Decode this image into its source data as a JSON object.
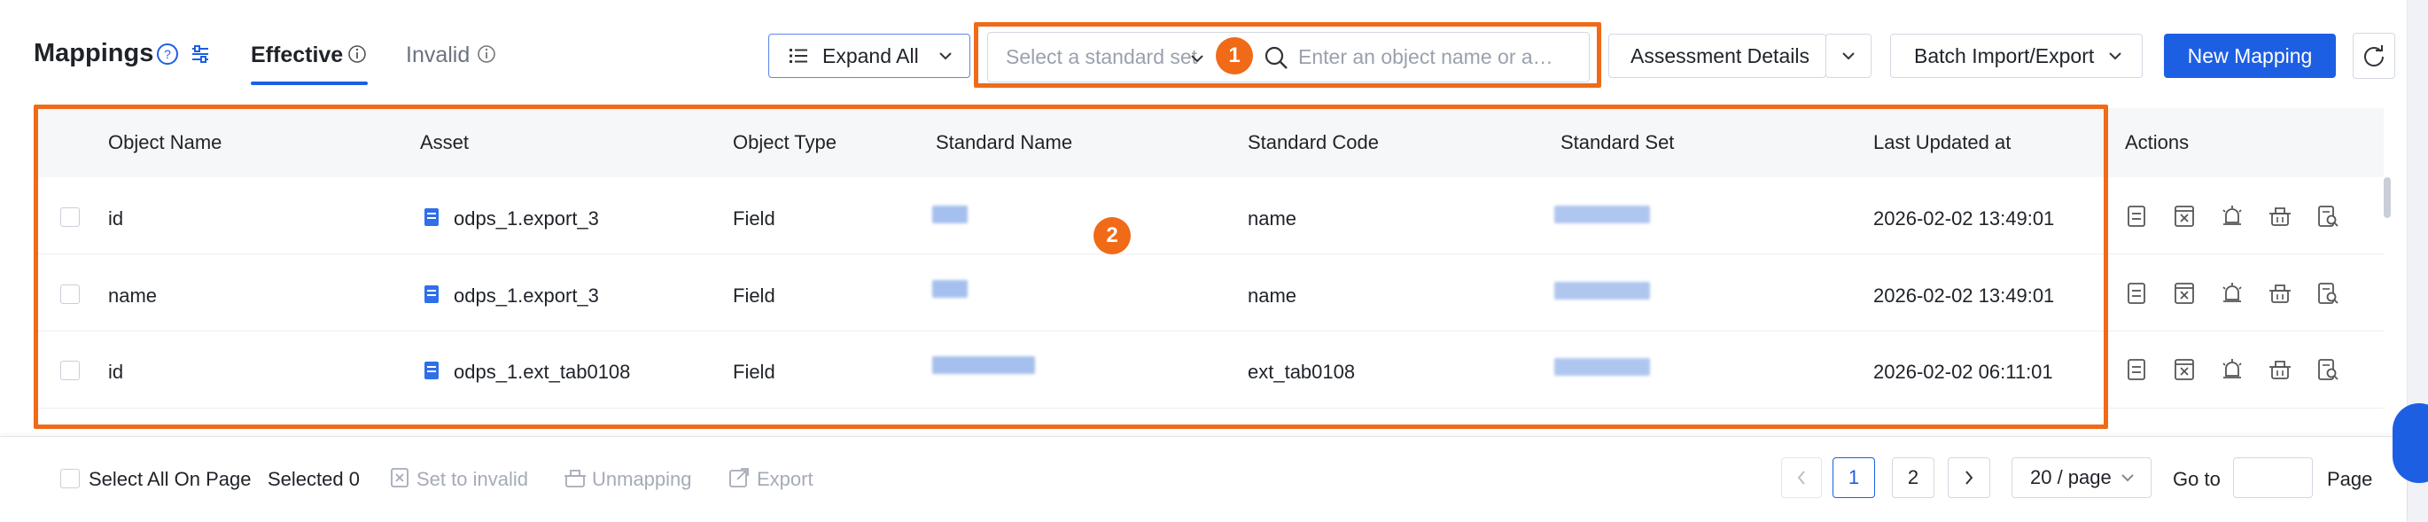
{
  "header": {
    "title": "Mappings",
    "tabs": [
      {
        "label": "Effective",
        "active": true
      },
      {
        "label": "Invalid",
        "active": false
      }
    ],
    "expand_all_label": "Expand All",
    "standard_set_placeholder": "Select a standard set",
    "search_placeholder": "Enter an object name or a…",
    "assessment_details_label": "Assessment Details",
    "batch_label": "Batch Import/Export",
    "new_mapping_label": "New Mapping"
  },
  "callouts": {
    "one": "1",
    "two": "2"
  },
  "table": {
    "columns": [
      "Object Name",
      "Asset",
      "Object Type",
      "Standard Name",
      "Standard Code",
      "Standard Set",
      "Last Updated at",
      "Actions"
    ],
    "rows": [
      {
        "object_name": "id",
        "asset": "odps_1.export_3",
        "object_type": "Field",
        "standard_code": "name",
        "last_updated": "2026-02-02 13:49:01"
      },
      {
        "object_name": "name",
        "asset": "odps_1.export_3",
        "object_type": "Field",
        "standard_code": "name",
        "last_updated": "2026-02-02 13:49:01"
      },
      {
        "object_name": "id",
        "asset": "odps_1.ext_tab0108",
        "object_type": "Field",
        "standard_code": "ext_tab0108",
        "last_updated": "2026-02-02 06:11:01"
      }
    ],
    "action_icons": [
      "detail-icon",
      "invalidate-icon",
      "alert-icon",
      "unmap-icon",
      "search-doc-icon"
    ]
  },
  "footer": {
    "select_all_label": "Select All On Page",
    "selected_label": "Selected 0",
    "set_invalid_label": "Set to invalid",
    "unmapping_label": "Unmapping",
    "export_label": "Export",
    "pages": [
      "1",
      "2"
    ],
    "current_page": "1",
    "page_size_label": "20 / page",
    "goto_label": "Go to",
    "page_label": "Page"
  },
  "colors": {
    "accent": "#1d5fe3",
    "callout": "#f06a18"
  }
}
